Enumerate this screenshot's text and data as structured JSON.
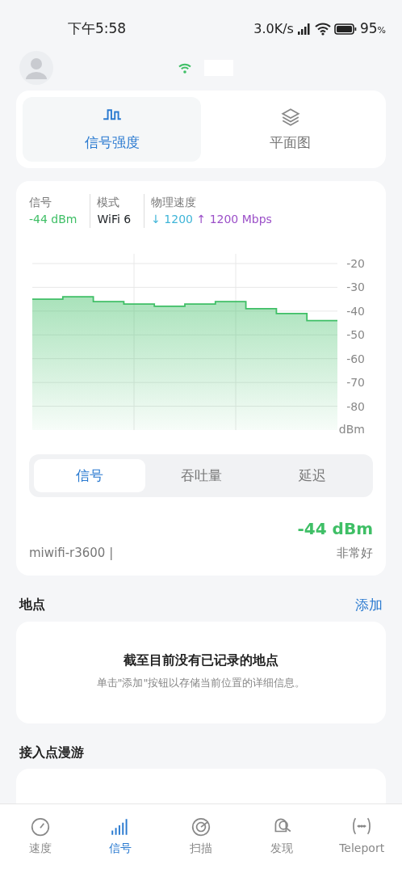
{
  "status_bar": {
    "time": "下午5:58",
    "net_speed": "3.0K/s",
    "battery": "95",
    "battery_unit": "%"
  },
  "view_tabs": [
    {
      "label": "信号强度",
      "selected": true
    },
    {
      "label": "平面图",
      "selected": false
    }
  ],
  "stats": {
    "signal_label": "信号",
    "signal_value": "-44 dBm",
    "mode_label": "模式",
    "mode_value": "WiFi 6",
    "speed_label": "物理速度",
    "down_arrow": "↓",
    "down_value": "1200",
    "up_arrow": "↑",
    "up_value": "1200 Mbps"
  },
  "chart": {
    "kind": "picture",
    "axis_labels": [
      "-20",
      "-30",
      "-40",
      "-50",
      "-60",
      "-70",
      "-80"
    ],
    "unit": "dBm"
  },
  "metric_tabs": [
    {
      "label": "信号",
      "selected": true
    },
    {
      "label": "吞吐量",
      "selected": false
    },
    {
      "label": "延迟",
      "selected": false
    }
  ],
  "reading": {
    "value": "-44 dBm",
    "network": "miwifi-r3600 |",
    "quality": "非常好"
  },
  "places": {
    "title": "地点",
    "action": "添加",
    "empty_title": "截至目前没有已记录的地点",
    "empty_text": "单击\"添加\"按钮以存储当前位置的详细信息。"
  },
  "roaming": {
    "title": "接入点漫游"
  },
  "bottom_nav": [
    {
      "label": "速度",
      "selected": false
    },
    {
      "label": "信号",
      "selected": true
    },
    {
      "label": "扫描",
      "selected": false
    },
    {
      "label": "发现",
      "selected": false
    },
    {
      "label": "Teleport",
      "selected": false
    }
  ]
}
